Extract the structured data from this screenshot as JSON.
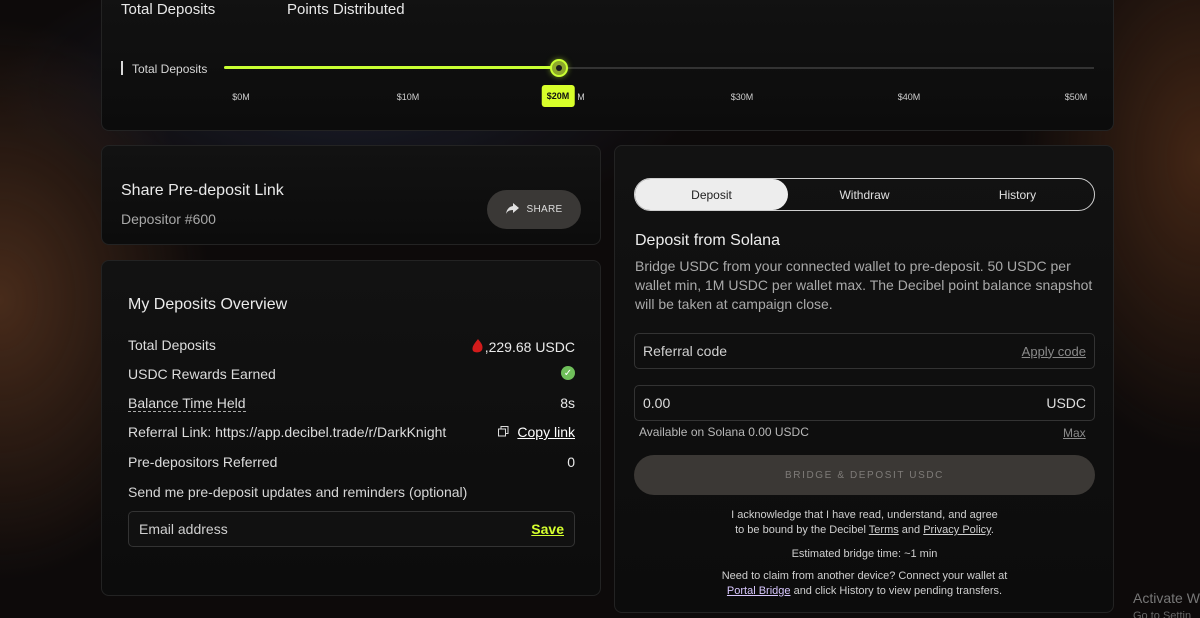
{
  "stats": {
    "total_deposits_label": "Total Deposits",
    "points_distributed_label": "Points Distributed"
  },
  "slider": {
    "label": "Total Deposits",
    "ticks": [
      "$0M",
      "$10M",
      "M",
      "$30M",
      "$40M",
      "$50M"
    ],
    "active_tick": "$20M",
    "progress_fraction": 0.385,
    "accent_color": "#c9ff32"
  },
  "share": {
    "title": "Share Pre-deposit Link",
    "depositor": "Depositor #600",
    "button_label": "SHARE",
    "button_icon": "share-arrow-icon"
  },
  "overview": {
    "title": "My Deposits Overview",
    "rows": [
      {
        "label": "Total Deposits",
        "value": ",229.68 USDC"
      },
      {
        "label": "USDC Rewards Earned",
        "value_icon": "check-circle-icon"
      },
      {
        "label": "Balance Time Held",
        "value": "8s"
      },
      {
        "label": "Referral Link: https://app.decibel.trade/r/DarkKnight",
        "value": "Copy link"
      },
      {
        "label": "Pre-depositors Referred",
        "value": "0"
      }
    ],
    "opt_in_text": "Send me pre-deposit updates and reminders (optional)",
    "email_placeholder": "Email address",
    "save_label": "Save"
  },
  "deposit": {
    "tabs": [
      "Deposit",
      "Withdraw",
      "History"
    ],
    "active_tab": "Deposit",
    "title": "Deposit from Solana",
    "description": "Bridge USDC from your connected wallet to pre-deposit. 50 USDC per wallet min, 1M USDC per wallet max. The Decibel point balance snapshot will be taken at campaign close.",
    "referral_placeholder": "Referral code",
    "apply_label": "Apply code",
    "amount_value": "0.00",
    "amount_unit": "USDC",
    "available_text": "Available on Solana 0.00 USDC",
    "max_label": "Max",
    "bridge_button": "BRIDGE & DEPOSIT USDC",
    "ack_line1": "I acknowledge that I have read, understand, and agree",
    "ack_prefix": "to be bound by the Decibel ",
    "terms_label": "Terms",
    "and_text": " and ",
    "privacy_label": "Privacy Policy",
    "period": ".",
    "bridge_time": "Estimated bridge time: ~1 min",
    "claim_line1": "Need to claim from another device? Connect your wallet at",
    "portal_label": "Portal Bridge",
    "claim_line2_suffix": " and click History to view pending transfers."
  },
  "os_watermark": {
    "title": "Activate W",
    "subtitle": "Go to Settin"
  }
}
